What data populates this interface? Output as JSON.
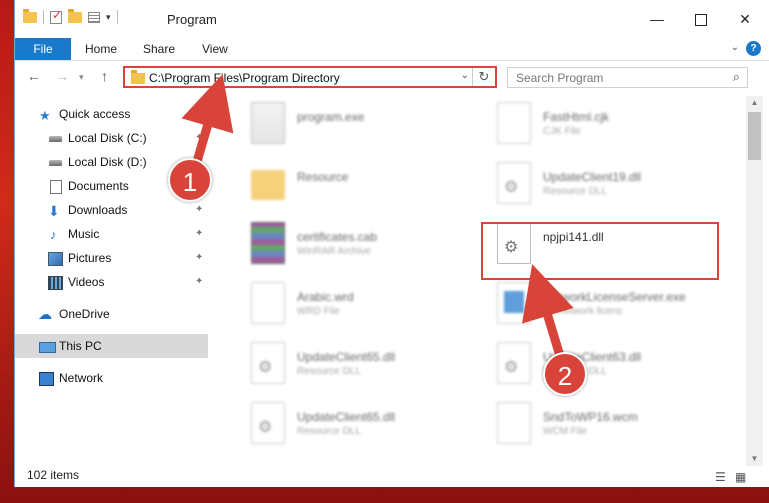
{
  "title": "Program",
  "window_buttons": {
    "minimize": "—",
    "close": "✕"
  },
  "ribbon": {
    "file": "File",
    "tabs": [
      "Home",
      "Share",
      "View"
    ],
    "help": "?"
  },
  "address": {
    "path": "C:\\Program Files\\Program Directory"
  },
  "search": {
    "placeholder": "Search Program"
  },
  "sidebar": {
    "items": [
      {
        "label": "Quick access",
        "icon": "star-icon"
      },
      {
        "label": "Local Disk (C:)",
        "icon": "disk-icon"
      },
      {
        "label": "Local Disk (D:)",
        "icon": "disk-icon"
      },
      {
        "label": "Documents",
        "icon": "documents-icon"
      },
      {
        "label": "Downloads",
        "icon": "download-icon"
      },
      {
        "label": "Music",
        "icon": "music-icon"
      },
      {
        "label": "Pictures",
        "icon": "pictures-icon"
      },
      {
        "label": "Videos",
        "icon": "videos-icon"
      },
      {
        "label": "OneDrive",
        "icon": "cloud-icon"
      },
      {
        "label": "This PC",
        "icon": "computer-icon"
      },
      {
        "label": "Network",
        "icon": "network-icon"
      }
    ]
  },
  "files": [
    {
      "name": "program.exe",
      "type": ""
    },
    {
      "name": "FastHtml.cjk",
      "type": "CJK File"
    },
    {
      "name": "Resource",
      "type": ""
    },
    {
      "name": "UpdateClient19.dll",
      "type": "Resource DLL"
    },
    {
      "name": "certificates.cab",
      "type": "WinRAR Archive"
    },
    {
      "name": "npjpi141.dll",
      "type": ""
    },
    {
      "name": "Arabic.wrd",
      "type": "WRD File"
    },
    {
      "name": "NetworkLicenseServer.exe",
      "type": "EY network licens"
    },
    {
      "name": "UpdateClient65.dll",
      "type": "Resource DLL"
    },
    {
      "name": "UpdateClient63.dll",
      "type": "Resource DLL"
    },
    {
      "name": "UpdateClient65.dll",
      "type": "Resource DLL"
    },
    {
      "name": "SndToWP16.wcm",
      "type": "WCM File"
    }
  ],
  "status": {
    "items": "102 items"
  },
  "annotations": {
    "step1": "1",
    "step2": "2"
  },
  "colors": {
    "accent": "#1979ca",
    "highlight": "#d9443a",
    "selected": "#d9d9d9"
  }
}
